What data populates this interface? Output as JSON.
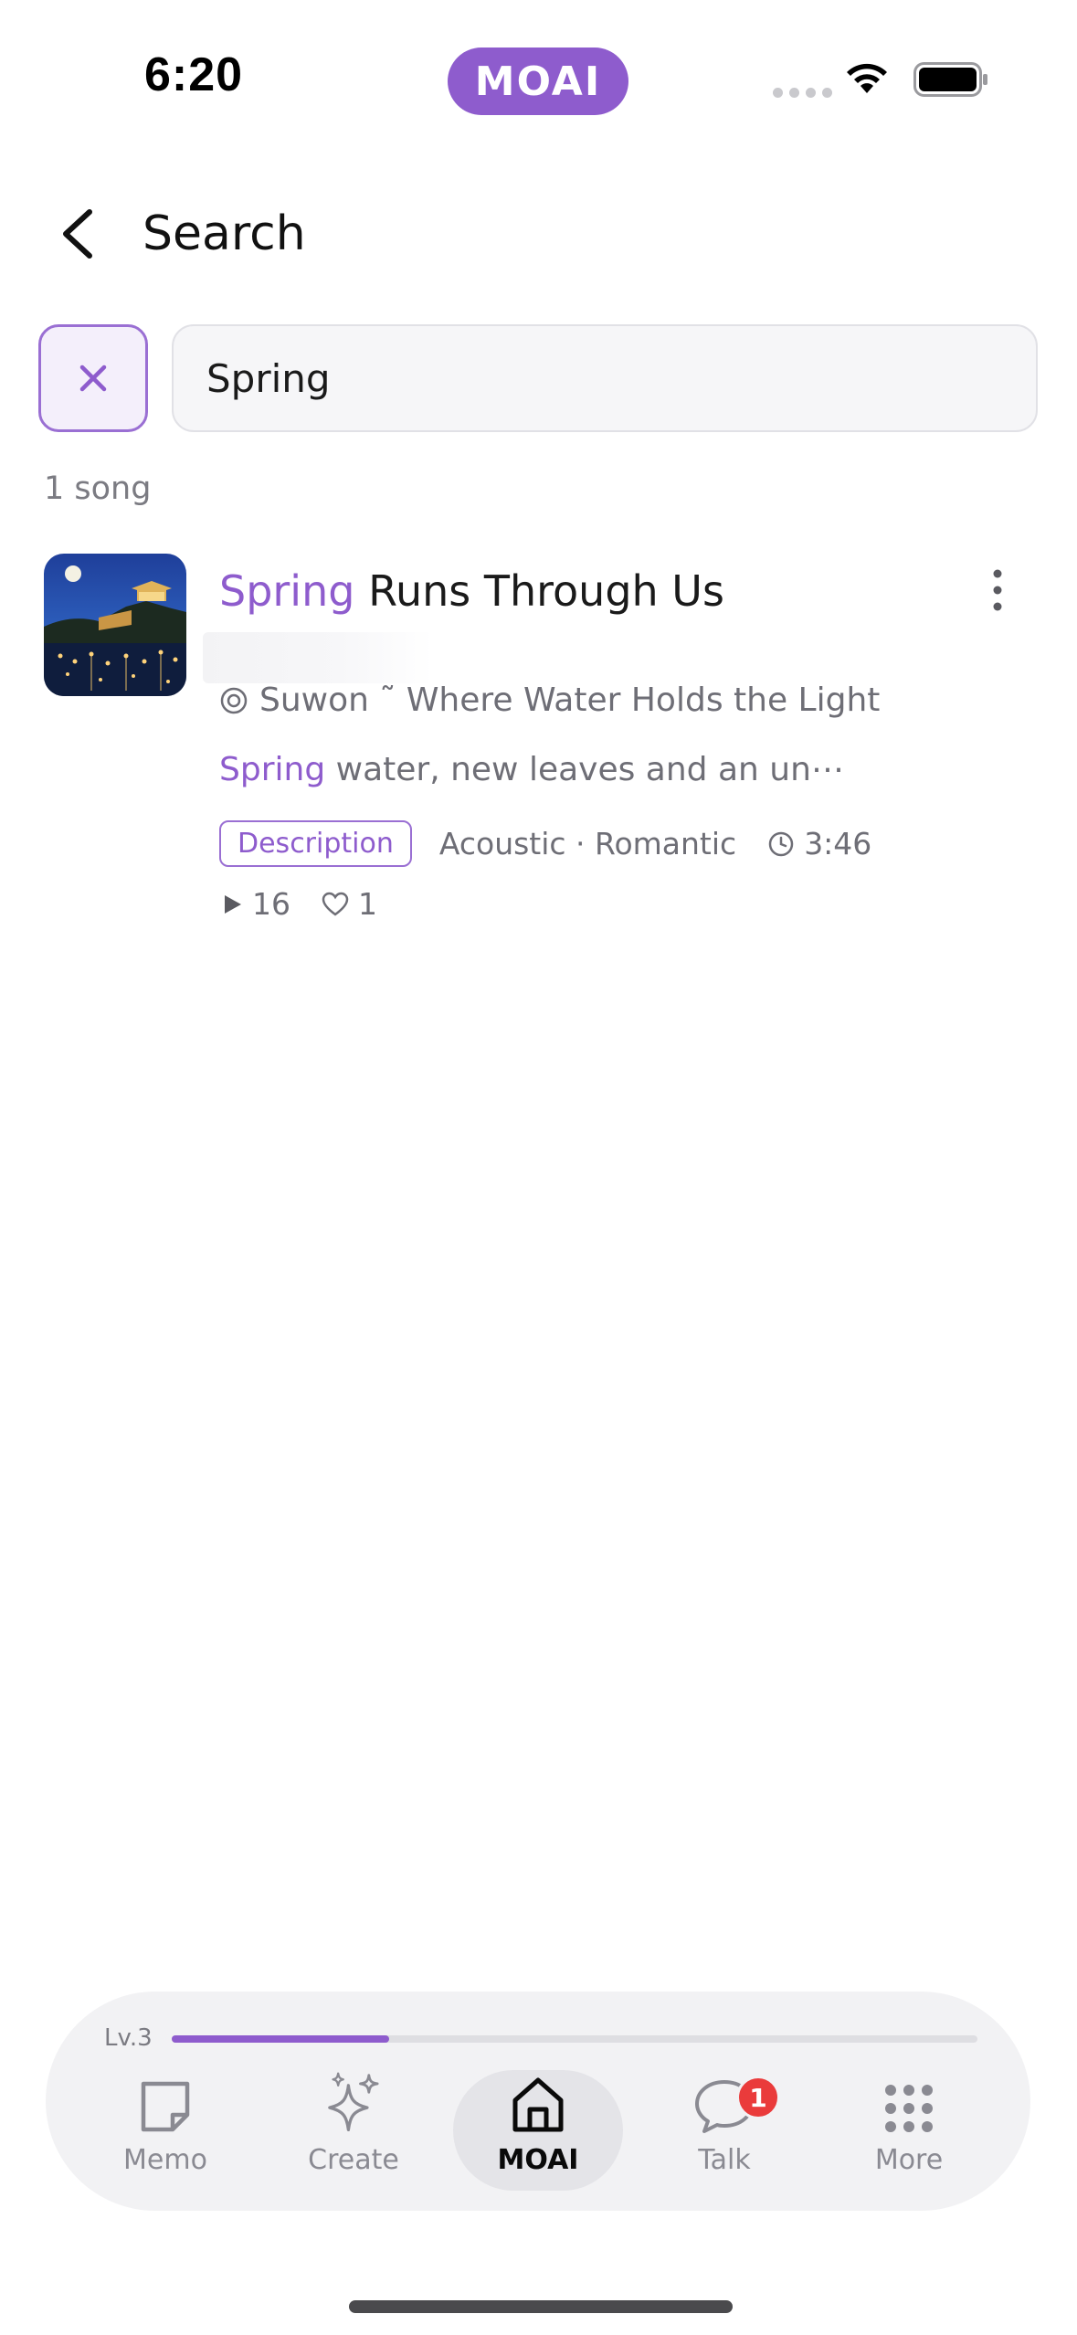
{
  "status_bar": {
    "time": "6:20",
    "app_pill": "MOAI",
    "accent": "#8e5ccd"
  },
  "header": {
    "back_icon": "chevron-left-icon",
    "title": "Search"
  },
  "search": {
    "clear_icon": "close-icon",
    "query": "Spring",
    "result_count": "1 song"
  },
  "results": [
    {
      "title_highlight": "Spring",
      "title_rest": " Runs Through Us",
      "location": "Suwon ˜  Where Water Holds the Light",
      "snippet_highlight": "Spring",
      "snippet_rest": " water, new leaves and an un⋯",
      "badge": "Description",
      "genres": "Acoustic · Romantic",
      "duration": "3:46",
      "plays": "16",
      "likes": "1"
    }
  ],
  "tabbar": {
    "level": "Lv.3",
    "level_progress": 0.27,
    "tabs": [
      {
        "label": "Memo",
        "icon": "memo-icon"
      },
      {
        "label": "Create",
        "icon": "sparkle-icon"
      },
      {
        "label": "MOAI",
        "icon": "home-icon",
        "active": true
      },
      {
        "label": "Talk",
        "icon": "chat-icon",
        "badge": "1"
      },
      {
        "label": "More",
        "icon": "grid-icon"
      }
    ]
  }
}
